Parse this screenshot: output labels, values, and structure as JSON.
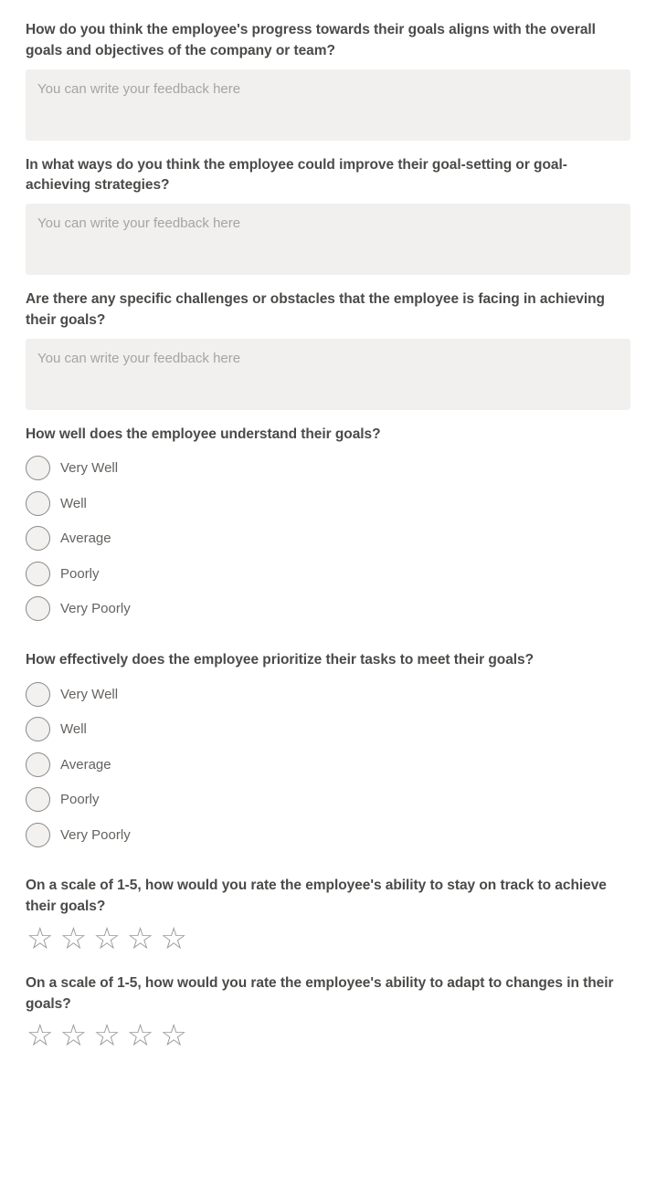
{
  "form": {
    "questions": [
      {
        "type": "text",
        "id": "goals-alignment",
        "title": "How do you think the employee's progress towards their goals aligns with the overall goals and objectives of the company or team?",
        "placeholder": "You can write your feedback here",
        "value": ""
      },
      {
        "type": "text",
        "id": "improve-strategies",
        "title": "In what ways do you think the employee could improve their goal-setting or goal-achieving strategies?",
        "placeholder": "You can write your feedback here",
        "value": ""
      },
      {
        "type": "text",
        "id": "challenges-obstacles",
        "title": "Are there any specific challenges or obstacles that the employee is facing in achieving their goals?",
        "placeholder": "You can write your feedback here",
        "value": ""
      },
      {
        "type": "radio",
        "id": "understand-goals",
        "title": "How well does the employee understand their goals?",
        "options": [
          "Very Well",
          "Well",
          "Average",
          "Poorly",
          "Very Poorly"
        ],
        "selected": null
      },
      {
        "type": "radio",
        "id": "prioritize-tasks",
        "title": "How effectively does the employee prioritize their tasks to meet their goals?",
        "options": [
          "Very Well",
          "Well",
          "Average",
          "Poorly",
          "Very Poorly"
        ],
        "selected": null
      },
      {
        "type": "rating",
        "id": "stay-on-track",
        "title": "On a scale of 1-5, how would you rate the employee's ability to stay on track to achieve their goals?",
        "max": 5,
        "value": 0,
        "star_empty_glyph": "☆",
        "star_filled_glyph": "★"
      },
      {
        "type": "rating",
        "id": "adapt-to-changes",
        "title": "On a scale of 1-5, how would you rate the employee's ability to adapt to changes in their goals?",
        "max": 5,
        "value": 0,
        "star_empty_glyph": "☆",
        "star_filled_glyph": "★"
      }
    ]
  },
  "colors": {
    "page_background": "#ffffff",
    "question_text": "#4b4a48",
    "option_text": "#65625f",
    "textarea_background": "#f1f0ee",
    "placeholder_text": "#a6a4a1",
    "radio_border": "#8a8886",
    "radio_fill": "#f2f1ef",
    "star_empty": "#9b9997"
  }
}
